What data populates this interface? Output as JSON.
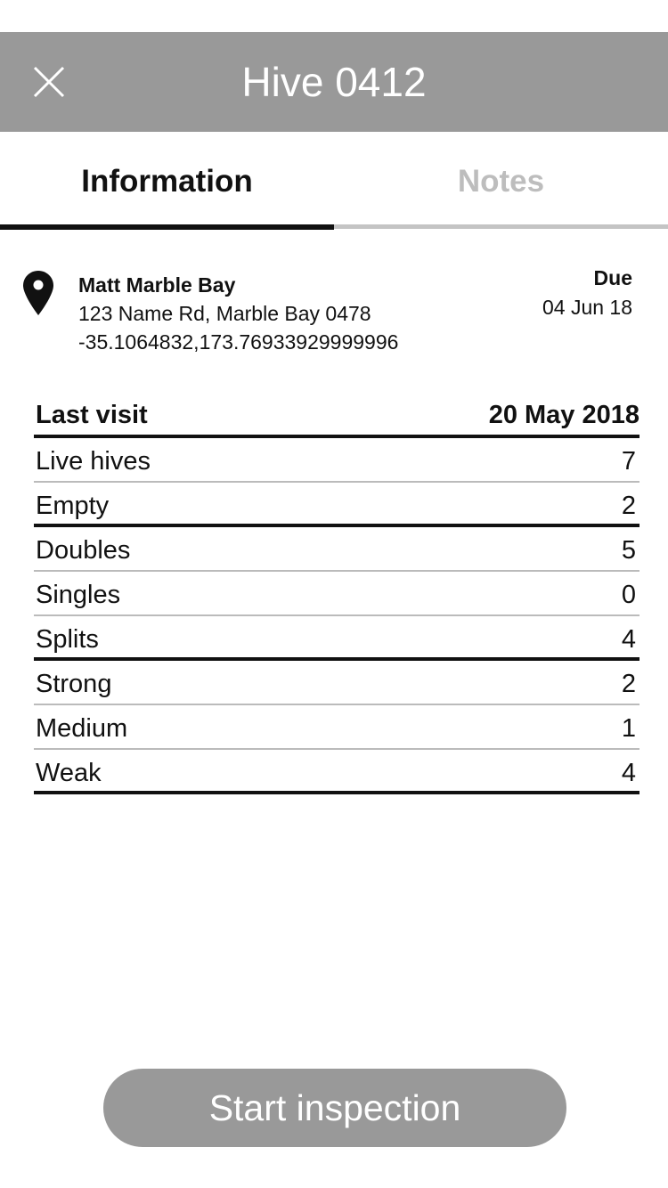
{
  "header": {
    "title": "Hive 0412",
    "close_icon": "close-icon"
  },
  "tabs": [
    {
      "label": "Information",
      "active": true
    },
    {
      "label": "Notes",
      "active": false
    }
  ],
  "location": {
    "icon": "map-pin-icon",
    "name": "Matt Marble Bay",
    "address": "123 Name Rd, Marble Bay 0478",
    "coordinates": "-35.1064832,173.76933929999996"
  },
  "due": {
    "label": "Due",
    "date": "04 Jun 18"
  },
  "last_visit": {
    "label": "Last visit",
    "date": "20 May 2018",
    "rows": [
      {
        "label": "Live hives",
        "value": "7"
      },
      {
        "label": "Empty",
        "value": "2"
      },
      {
        "label": "Doubles",
        "value": "5"
      },
      {
        "label": "Singles",
        "value": "0"
      },
      {
        "label": "Splits",
        "value": "4"
      },
      {
        "label": "Strong",
        "value": "2"
      },
      {
        "label": "Medium",
        "value": "1"
      },
      {
        "label": "Weak",
        "value": "4"
      }
    ]
  },
  "actions": {
    "start_label": "Start inspection"
  },
  "colors": {
    "header_bg": "#999999",
    "button_bg": "#999999",
    "active_tab": "#111111",
    "inactive_tab": "#bdbdbd"
  }
}
